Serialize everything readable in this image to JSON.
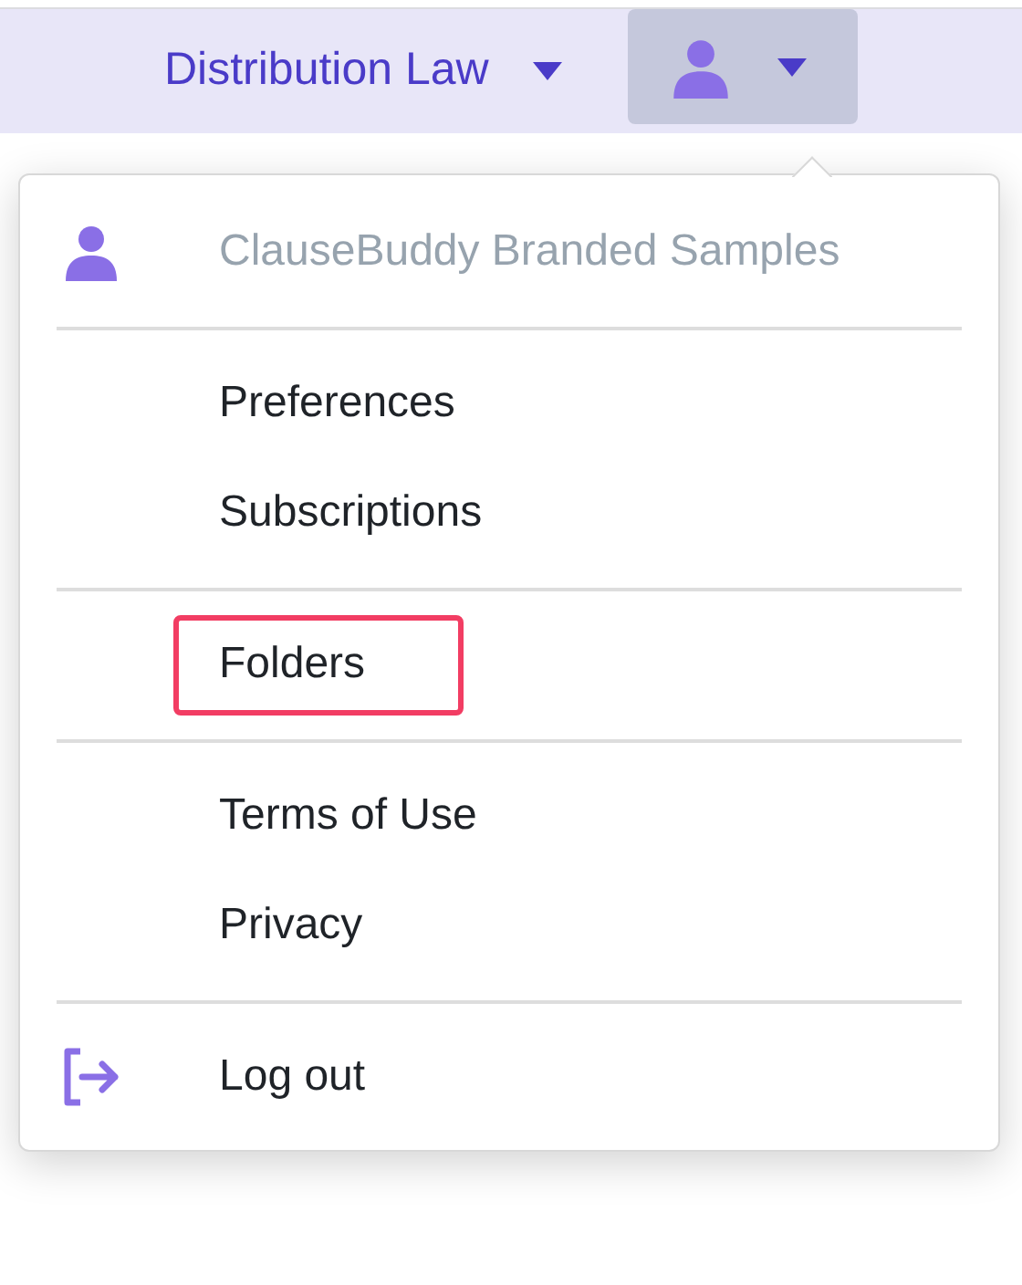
{
  "navbar": {
    "workspace": {
      "label": "Distribution Law"
    }
  },
  "menu": {
    "account": {
      "label": "ClauseBuddy Branded Samples"
    },
    "sections": [
      {
        "items": [
          {
            "label": "Preferences",
            "highlighted": false
          },
          {
            "label": "Subscriptions",
            "highlighted": false
          }
        ]
      },
      {
        "items": [
          {
            "label": "Folders",
            "highlighted": true
          }
        ]
      },
      {
        "items": [
          {
            "label": "Terms of Use",
            "highlighted": false
          },
          {
            "label": "Privacy",
            "highlighted": false
          }
        ]
      }
    ],
    "logout": {
      "label": "Log out"
    }
  }
}
